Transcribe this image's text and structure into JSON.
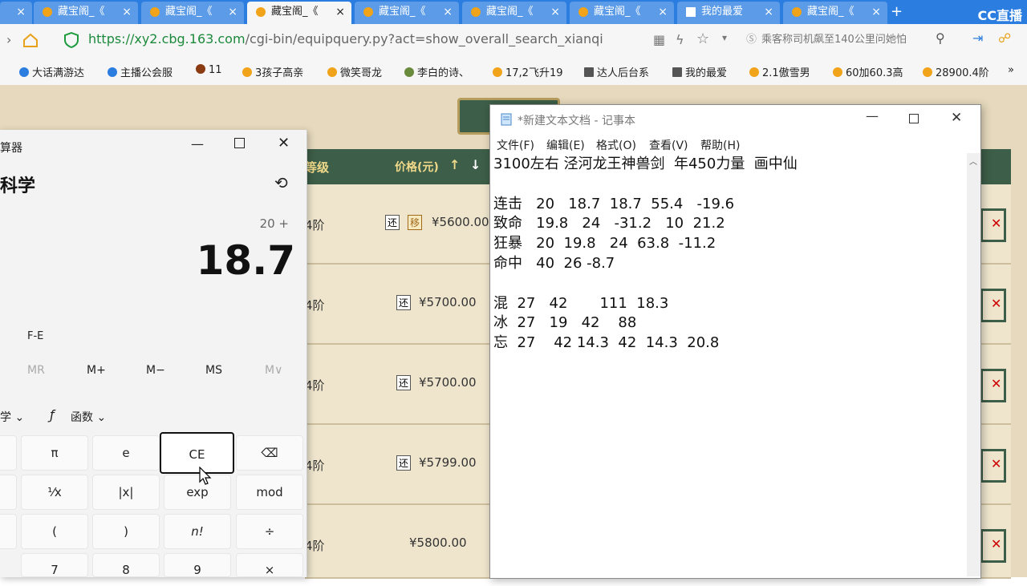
{
  "browser": {
    "tabs": [
      {
        "label": "藏宝阁_《"
      },
      {
        "label": "藏宝阁_《"
      },
      {
        "label": "藏宝阁_《"
      },
      {
        "label": "藏宝阁_《"
      },
      {
        "label": "藏宝阁_《"
      },
      {
        "label": "藏宝阁_《"
      },
      {
        "label": "我的最爱"
      },
      {
        "label": "藏宝阁_《"
      }
    ],
    "close_glyph": "×",
    "cc_logo": "CC直播",
    "url_prefix": "https://",
    "url_host": "xy2.cbg.163.com",
    "url_rest": "/cgi-bin/equipquery.py?act=show_overall_search_xianqi",
    "search_text": "乘客称司机飙至140公里问她怕",
    "bookmarks": [
      "大话满游达",
      "主播公会服",
      "11",
      "3孩子高亲",
      "微笑哥龙",
      "李白的诗、",
      "17,2飞升19",
      "达人后台系",
      "我的最爱",
      "2.1傲雪男",
      "60加60.3高",
      "28900.4阶"
    ],
    "colors": {
      "tabstrip": "#2b7de0",
      "page_bg": "#e6d9bd",
      "header_green": "#3d5e48"
    }
  },
  "page": {
    "col_level": "等级",
    "col_price": "价格(元)",
    "sort_up": "↑",
    "sort_down": "↓",
    "level_suffix": "4阶",
    "tag_huan": "还",
    "tag_yi": "移",
    "prices": [
      "¥5600.00",
      "¥5700.00",
      "¥5700.00",
      "¥5799.00",
      "¥5800.00"
    ]
  },
  "calculator": {
    "title": "算器",
    "mode": "科学",
    "expression": "20 +",
    "display": "18.7",
    "fe_label": "F-E",
    "memory": [
      "MR",
      "M+",
      "M−",
      "MS",
      "M∨"
    ],
    "trig_label": "学",
    "func_label": "函数",
    "buttons": [
      "π",
      "e",
      "CE",
      "⌫",
      "¹⁄x",
      "|x|",
      "exp",
      "mod",
      "(",
      ")",
      "n!",
      "÷",
      "7",
      "8",
      "9",
      "×"
    ]
  },
  "notepad": {
    "title": "*新建文本文档 - 记事本",
    "menu": [
      "文件(F)",
      "编辑(E)",
      "格式(O)",
      "查看(V)",
      "帮助(H)"
    ],
    "lines": [
      "3100左右 泾河龙王神兽剑  年450力量  画中仙",
      "",
      "连击   20   18.7  18.7  55.4   -19.6",
      "致命   19.8   24   -31.2   10  21.2",
      "狂暴   20  19.8   24  63.8  -11.2",
      "命中   40  26 -8.7",
      "",
      "混  27   42       111  18.3",
      "冰  27   19   42    88",
      "忘  27    42 14.3  42  14.3  20.8"
    ]
  }
}
